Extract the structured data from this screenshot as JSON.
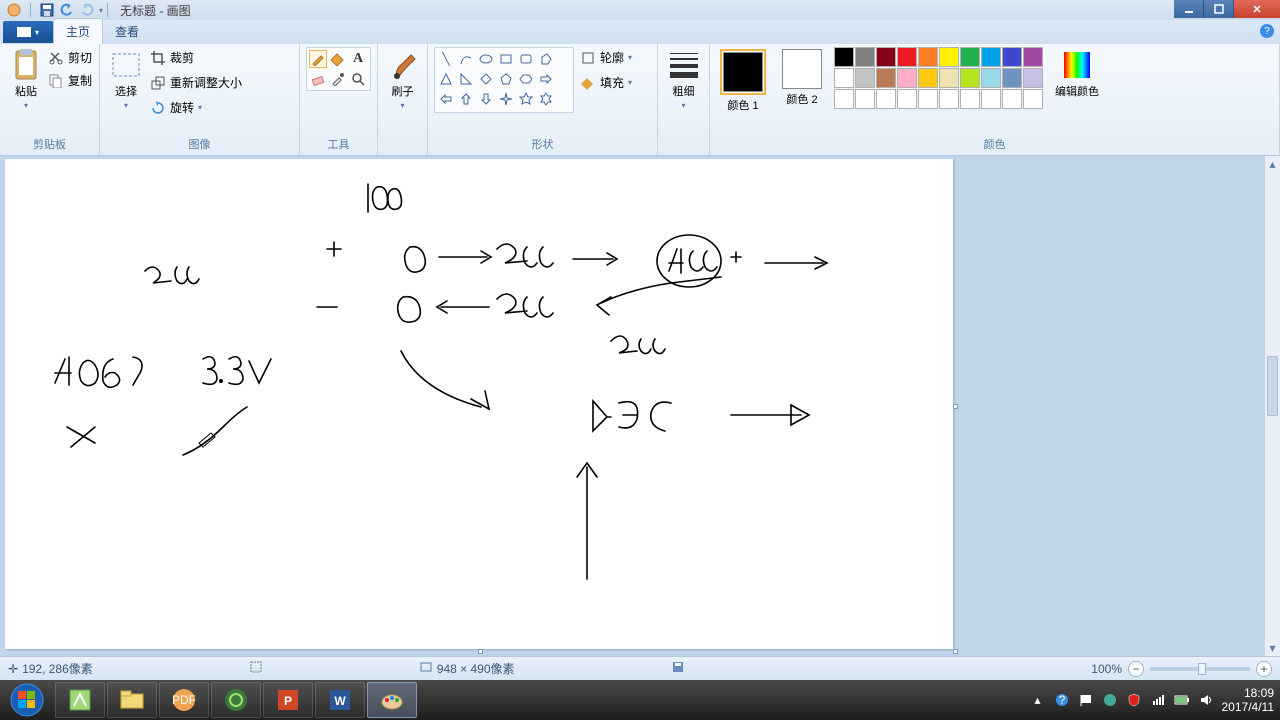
{
  "title": "无标题 - 画图",
  "tabs": {
    "file_icon": "▤",
    "home": "主页",
    "view": "查看"
  },
  "ribbon": {
    "clipboard": {
      "paste": "粘贴",
      "cut": "剪切",
      "copy": "复制",
      "label": "剪贴板"
    },
    "image": {
      "select": "选择",
      "crop": "裁剪",
      "resize": "重新调整大小",
      "rotate": "旋转",
      "label": "图像"
    },
    "tools": {
      "label": "工具"
    },
    "brushes": {
      "brush": "刷子"
    },
    "shapes": {
      "outline": "轮廓",
      "fill": "填充",
      "label": "形状"
    },
    "stroke": {
      "thickness": "粗细"
    },
    "colors": {
      "color1": "颜色 1",
      "color2": "颜色 2",
      "edit": "编辑颜色",
      "label": "颜色"
    }
  },
  "palette_row1": [
    "#000000",
    "#7f7f7f",
    "#880015",
    "#ed1c24",
    "#ff7f27",
    "#fff200",
    "#22b14c",
    "#00a2e8",
    "#3f48cc",
    "#a349a4"
  ],
  "palette_row2": [
    "#ffffff",
    "#c3c3c3",
    "#b97a57",
    "#ffaec9",
    "#ffc90e",
    "#efe4b0",
    "#b5e61d",
    "#99d9ea",
    "#7092be",
    "#c8bfe7"
  ],
  "status": {
    "cursor_pos": "192, 286像素",
    "canvas_size": "948 × 490像素",
    "zoom": "100%"
  },
  "color1": "#000000",
  "color2": "#ffffff",
  "taskbar": {
    "time": "18:09",
    "date": "2017/4/11"
  }
}
